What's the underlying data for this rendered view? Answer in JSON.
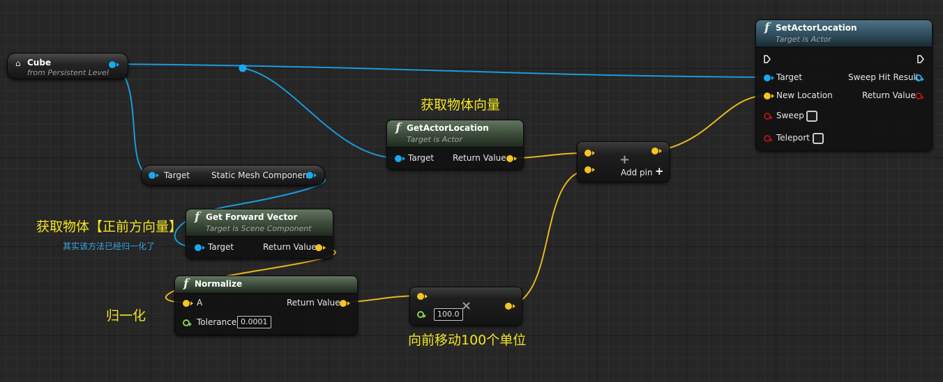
{
  "cube_node": {
    "title": "Cube",
    "subtitle": "from Persistent Level"
  },
  "static_mesh_node": {
    "input_label": "Target",
    "output_label": "Static Mesh Component"
  },
  "get_actor_location": {
    "title": "GetActorLocation",
    "subtitle": "Target is Actor",
    "input_label": "Target",
    "output_label": "Return Value"
  },
  "get_forward_vector": {
    "title": "Get Forward Vector",
    "subtitle": "Target is Scene Component",
    "input_label": "Target",
    "output_label": "Return Value"
  },
  "normalize": {
    "title": "Normalize",
    "input_a": "A",
    "output_label": "Return Value",
    "tolerance_label": "Tolerance",
    "tolerance_value": "0.0001"
  },
  "multiply": {
    "value": "100.0",
    "operator": "×"
  },
  "add": {
    "operator": "+",
    "add_pin_label": "Add pin",
    "add_pin_icon": "+"
  },
  "set_actor_location": {
    "title": "SetActorLocation",
    "subtitle": "Target is Actor",
    "target_label": "Target",
    "new_location_label": "New Location",
    "sweep_label": "Sweep",
    "teleport_label": "Teleport",
    "sweep_hit_result_label": "Sweep Hit Result",
    "return_value_label": "Return Value"
  },
  "comments": {
    "get_location": "获取物体向量",
    "get_forward": "获取物体【正前方向量】",
    "forward_note": "其实该方法已经归一化了",
    "normalize": "归一化",
    "move": "向前移动100个单位"
  },
  "colors": {
    "object_pin": "#1aa8f0",
    "vector_pin": "#f4c51f",
    "float_pin": "#8bd14a",
    "bool_pin": "#a8141c",
    "comment_text": "#f3e520"
  },
  "icons": {
    "function": "function-icon",
    "actor": "actor-icon",
    "exec": "exec-pin-icon"
  }
}
